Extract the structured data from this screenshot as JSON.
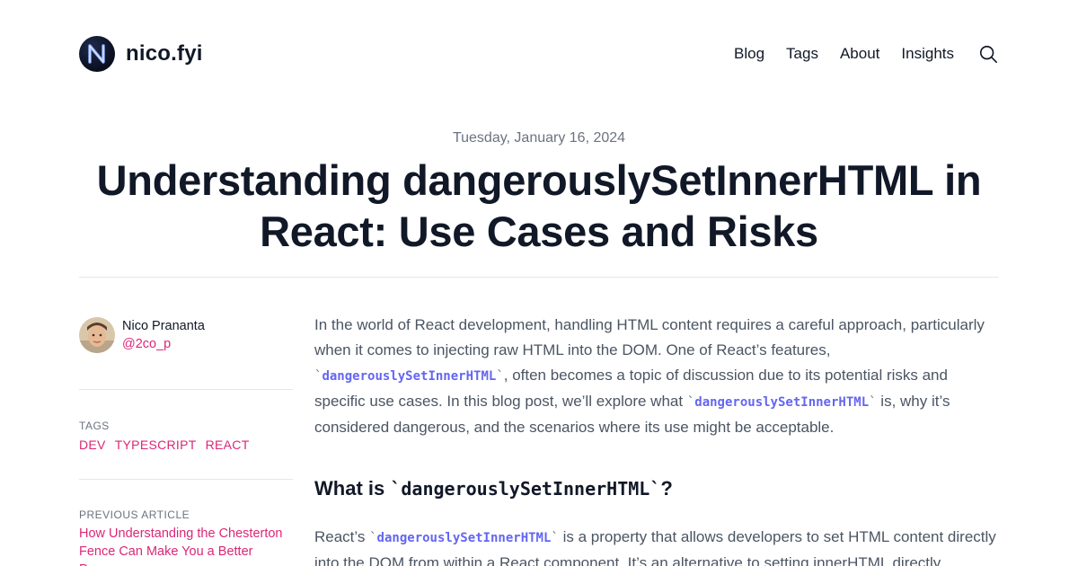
{
  "site": {
    "name": "nico.fyi",
    "logo_icon": "n-monogram-logo-icon"
  },
  "nav": {
    "items": [
      "Blog",
      "Tags",
      "About",
      "Insights"
    ],
    "search_icon": "search-icon"
  },
  "post": {
    "date": "Tuesday, January 16, 2024",
    "title": "Understanding dangerouslySetInnerHTML in React: Use Cases and Risks"
  },
  "sidebar": {
    "author": {
      "name": "Nico Prananta",
      "handle": "@2co_p"
    },
    "tags_label": "TAGS",
    "tags": [
      "DEV",
      "TYPESCRIPT",
      "REACT"
    ],
    "previous_label": "PREVIOUS ARTICLE",
    "previous_title": "How Understanding the Chesterton Fence Can Make You a Better Programmer"
  },
  "content": {
    "intro": {
      "a": "In the world of React development, handling HTML content requires a careful approach, particularly when it comes to injecting raw HTML into the DOM. One of React’s features, ",
      "code1": "dangerouslySetInnerHTML",
      "b": ", often becomes a topic of discussion due to its potential risks and specific use cases. In this blog post, we’ll explore what ",
      "code2": "dangerouslySetInnerHTML",
      "c": " is, why it’s considered dangerous, and the scenarios where its use might be acceptable."
    },
    "h2": {
      "a": "What is ",
      "code": "dangerouslySetInnerHTML",
      "b": "?"
    },
    "p2": {
      "a": "React’s ",
      "code": "dangerouslySetInnerHTML",
      "b": " is a property that allows developers to set HTML content directly into the DOM from within a React component. It’s an alternative to setting innerHTML directly."
    }
  },
  "colors": {
    "accent": "#db2777",
    "code": "#6366f1",
    "text": "#111827",
    "muted": "#6b7280",
    "body": "#4b5563",
    "rule": "#e5e7eb"
  }
}
